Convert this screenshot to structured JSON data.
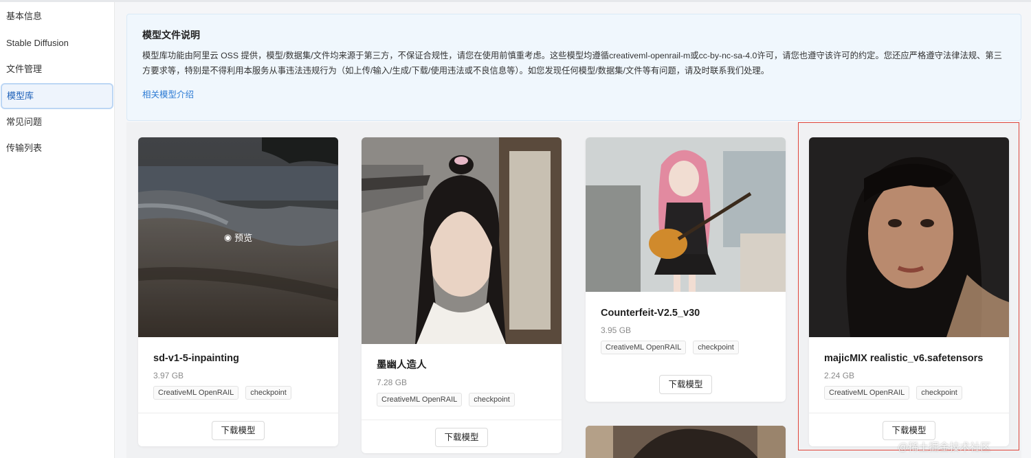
{
  "sidebar": {
    "items": [
      {
        "label": "基本信息"
      },
      {
        "label": "Stable Diffusion"
      },
      {
        "label": "文件管理"
      },
      {
        "label": "模型库"
      },
      {
        "label": "常见问题"
      },
      {
        "label": "传输列表"
      }
    ]
  },
  "notice": {
    "title": "模型文件说明",
    "text": "模型库功能由阿里云 OSS 提供，模型/数据集/文件均来源于第三方，不保证合规性，请您在使用前慎重考虑。这些模型均遵循creativeml-openrail-m或cc-by-nc-sa-4.0许可，请您也遵守该许可的约定。您还应严格遵守法律法规、第三方要求等，特别是不得利用本服务从事违法违规行为（如上传/输入/生成/下载/使用违法或不良信息等）。如您发现任何模型/数据集/文件等有问题，请及时联系我们处理。",
    "link": "相关模型介绍"
  },
  "preview_label": "预览",
  "download_label": "下载模型",
  "cards": [
    {
      "title": "sd-v1-5-inpainting",
      "size": "3.97 GB",
      "tags": [
        "CreativeML OpenRAIL",
        "checkpoint"
      ]
    },
    {
      "title": "墨幽人造人",
      "size": "7.28 GB",
      "tags": [
        "CreativeML OpenRAIL",
        "checkpoint"
      ]
    },
    {
      "title": "Counterfeit-V2.5_v30",
      "size": "3.95 GB",
      "tags": [
        "CreativeML OpenRAIL",
        "checkpoint"
      ]
    },
    {
      "title": "majicMIX realistic_v6.safetensors",
      "size": "2.24 GB",
      "tags": [
        "CreativeML OpenRAIL",
        "checkpoint"
      ]
    }
  ],
  "watermark": "@稀土掘金技术社区",
  "colors": {
    "accent": "#2d7bd4",
    "active_bg": "#eef4fc",
    "highlight": "#e0443a"
  }
}
